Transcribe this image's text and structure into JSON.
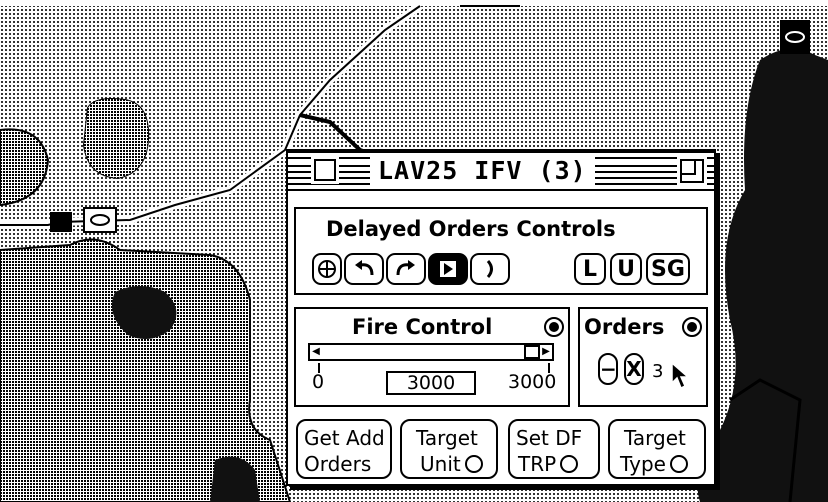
{
  "window": {
    "title": "LAV25 IFV (3)"
  },
  "delayed_orders": {
    "title": "Delayed Orders Controls",
    "icons": [
      "rotate-icon",
      "undo-icon",
      "redo-icon",
      "play-icon",
      "end-icon"
    ],
    "buttons": {
      "l": "L",
      "u": "U",
      "sg": "SG"
    }
  },
  "fire_control": {
    "title": "Fire Control",
    "selected": true,
    "slider": {
      "min": "0",
      "max": "3000",
      "value": "3000",
      "level": 1.0
    }
  },
  "orders": {
    "title": "Orders",
    "selected": true,
    "minus": "−",
    "x": "X",
    "count": "3"
  },
  "commands": [
    {
      "line1": "Get Add",
      "line2": "Orders",
      "radio": false
    },
    {
      "line1": "Target",
      "line2": "Unit",
      "radio": true
    },
    {
      "line1": "Set DF",
      "line2": "TRP",
      "radio": true
    },
    {
      "line1": "Target",
      "line2": "Type",
      "radio": true
    }
  ]
}
